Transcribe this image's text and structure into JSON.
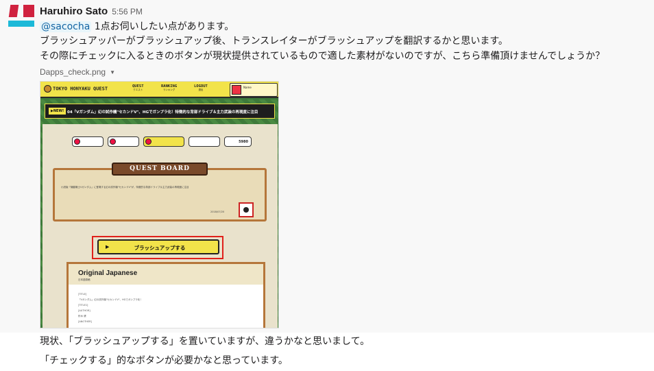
{
  "message": {
    "sender": "Haruhiro Sato",
    "time": "5:56 PM",
    "mention": "@sacocha",
    "line1_rest": " 1点お伺いしたい点があります。",
    "line2": "ブラッシュアッパーがブラッシュアップ後、トランスレイターがブラッシュアップを翻訳するかと思います。",
    "line3": "その際にチェックに入るときのボタンが現状提供されているもので適した素材がないのですが、こちら準備頂けませんでしょうか？"
  },
  "file": {
    "name": "Dapps_check.png"
  },
  "screenshot": {
    "logo": "TOKYO HONYAKU QUEST",
    "nav": [
      {
        "label": "QUEST",
        "sub": "クエスト"
      },
      {
        "label": "RANKING",
        "sub": "ランキング"
      },
      {
        "label": "LOGOUT",
        "sub": "退出"
      }
    ],
    "user_name": "Name",
    "banner_badge": "▶NEW!",
    "banner_text": "04「Vガンダム」幻の試作機\"セカンドV\"、HGでガンプラ化！特徴的な背部ドライブ＆主力武装の再現度に注目",
    "chip_count": "5980",
    "board_title": "QUEST BOARD",
    "board_text": "小説版「機動戦士Vガンダム」に登場する幻の試作機\"セカンドV\"が、特徴的な背部ドライブ＆主力武装の再現度に注目",
    "board_date": "2018/07/20",
    "cta_label": "ブラッシュアップする",
    "orig_title": "Original Japanese",
    "orig_sub": "日本語原稿",
    "orig_lines": [
      "[TITLE]",
      "「Vガンダム」幻の試作機\"セカンドV\"、HGでガンプラ化！",
      "[TITLE1]",
      "[AUTHOR]",
      "鈴木 健",
      "[ANOTHER]"
    ]
  },
  "followup": {
    "line1": "現状、「ブラッシュアップする」を置いていますが、違うかなと思いまして。",
    "line2": "「チェックする」的なボタンが必要かなと思っています。"
  },
  "colors": {
    "mention_bg": "#e8f5fa",
    "mention_fg": "#1264a3",
    "highlight_frame": "#e0201a",
    "cta_yellow": "#f2e34a"
  }
}
